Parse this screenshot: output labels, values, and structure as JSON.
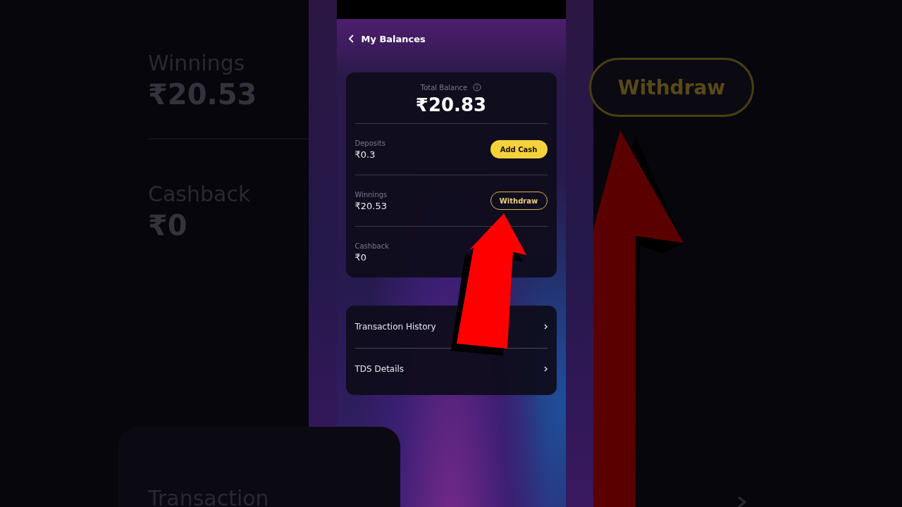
{
  "background_left": {
    "winnings_label": "Winnings",
    "winnings_value": "₹20.53",
    "cashback_label": "Cashback",
    "cashback_value": "₹0",
    "link_label": "Transaction"
  },
  "background_right": {
    "withdraw_button": "Withdraw"
  },
  "screen": {
    "title": "My Balances",
    "total": {
      "label": "Total Balance",
      "amount": "₹20.83"
    },
    "balances": [
      {
        "label": "Deposits",
        "amount": "₹0.3",
        "action": {
          "label": "Add Cash",
          "kind": "primary"
        }
      },
      {
        "label": "Winnings",
        "amount": "₹20.53",
        "action": {
          "label": "Withdraw",
          "kind": "outline"
        }
      },
      {
        "label": "Cashback",
        "amount": "₹0"
      }
    ],
    "links": [
      {
        "label": "Transaction History"
      },
      {
        "label": "TDS Details"
      }
    ]
  }
}
